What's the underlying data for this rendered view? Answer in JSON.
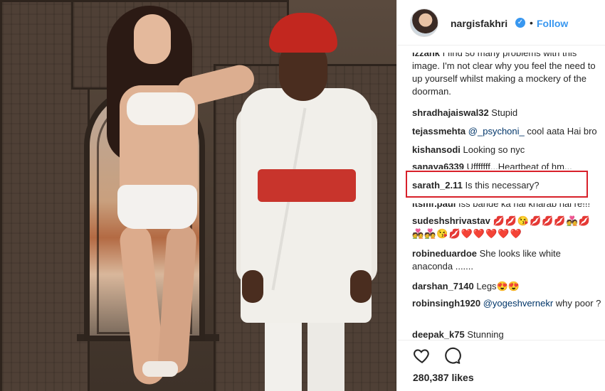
{
  "post": {
    "username": "nargisfakhri",
    "verified_mark": "✓",
    "dot": "•",
    "follow_label": "Follow",
    "likes": "280,387 likes"
  },
  "icons": [
    "heart-icon",
    "comment-icon",
    "verified-badge-icon"
  ],
  "colors": {
    "accent": "#3897f0",
    "highlight_box": "#d8202a",
    "text": "#262626"
  },
  "comments": [
    {
      "user": "izzank",
      "text": "I find so many problems with this image. I'm not clear why you feel the need to up yourself whilst making a mockery of the doorman."
    },
    {
      "user": "shradhajaiswal32",
      "text": "Stupid"
    },
    {
      "user": "tejassmehta",
      "mention": "@_psychoni_",
      "text": "cool aata Hai bro"
    },
    {
      "user": "kishansodi",
      "text": "Looking so nyc"
    },
    {
      "user": "sanaya6339",
      "text": "Ufffffff...Heartbeat of hm..."
    },
    {
      "user": "sarath_2.11",
      "text": "Is this necessary?"
    },
    {
      "user": "itsmr.paul",
      "text": "Iss bande ka hai kharab hai re!!!"
    },
    {
      "user": "sudeshshrivastav",
      "text": "💋💋😘💋💋💋💑💋",
      "text2": "💑💑😘💋❤️❤️❤️❤️❤️"
    },
    {
      "user": "robineduardoe",
      "text": "She looks like white anaconda ......."
    },
    {
      "user": "darshan_7140",
      "text": "Legs😍😍"
    },
    {
      "user": "robinsingh1920",
      "mention": "@yogeshvernekr",
      "text": "why poor ?"
    },
    {
      "user": "deepak_k75",
      "text": "Stunning"
    }
  ]
}
